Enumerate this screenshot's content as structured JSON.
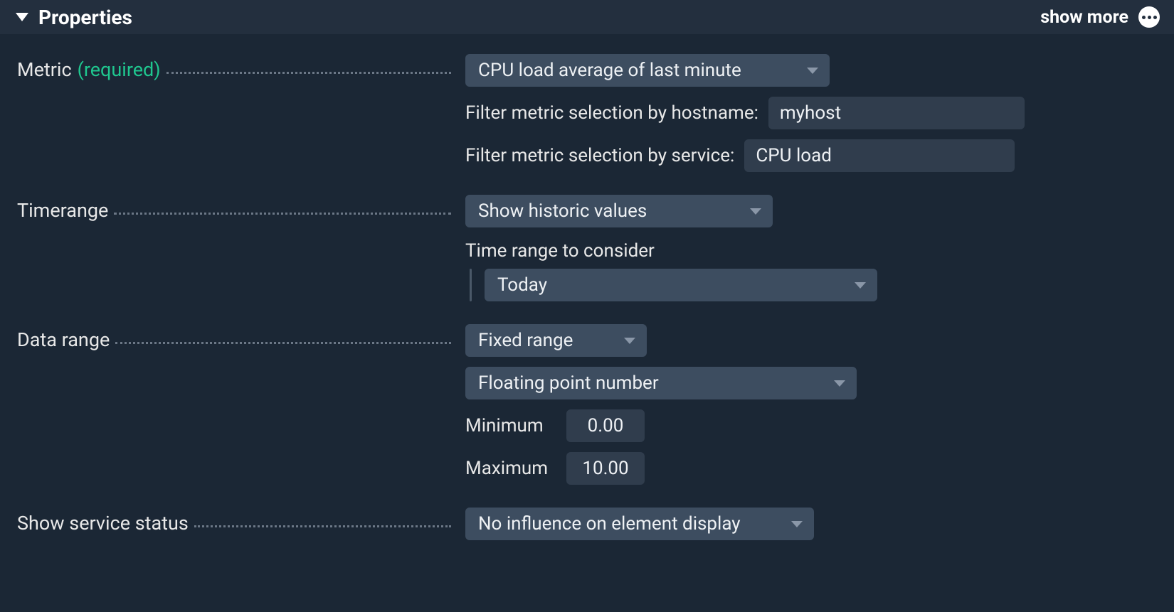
{
  "header": {
    "title": "Properties",
    "show_more": "show more"
  },
  "metric": {
    "label": "Metric",
    "required": "(required)",
    "select": "CPU load average of last minute",
    "filter_host_label": "Filter metric selection by hostname:",
    "filter_host_value": "myhost",
    "filter_service_label": "Filter metric selection by service:",
    "filter_service_value": "CPU load"
  },
  "timerange": {
    "label": "Timerange",
    "select": "Show historic values",
    "sub_label": "Time range to consider",
    "sub_select": "Today"
  },
  "datarange": {
    "label": "Data range",
    "select1": "Fixed range",
    "select2": "Floating point number",
    "min_label": "Minimum",
    "min_value": "0.00",
    "max_label": "Maximum",
    "max_value": "10.00"
  },
  "status": {
    "label": "Show service status",
    "select": "No influence on element display"
  }
}
